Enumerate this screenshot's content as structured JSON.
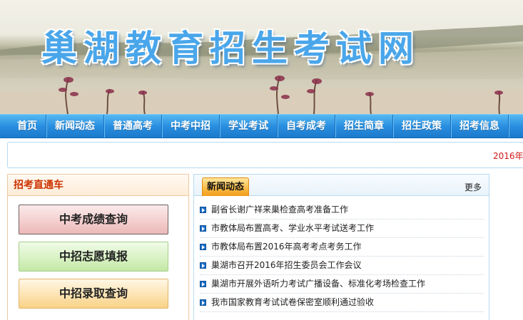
{
  "banner": {
    "title": "巢湖教育招生考试网"
  },
  "nav": {
    "items": [
      "首页",
      "新闻动态",
      "普通高考",
      "中考中招",
      "学业考试",
      "自考成考",
      "招生简章",
      "招生政策",
      "招考信息"
    ]
  },
  "marquee": {
    "text": "2016年"
  },
  "left_panel": {
    "title": "招考直通车",
    "buttons": {
      "score": "中考成绩查询",
      "wish": "中招志愿填报",
      "admit": "中招录取查询"
    }
  },
  "news": {
    "tab_label": "新闻动态",
    "more_label": "更多",
    "items": [
      "副省长谢广祥来巢检查高考准备工作",
      "市教体局布置高考、学业水平考试送考工作",
      "市教体局布置2016年高考考点考务工作",
      "巢湖市召开2016年招生委员会工作会议",
      "巢湖市开展外语听力考试广播设备、标准化考场检查工作",
      "我市国家教育考试试卷保密室顺利通过验收"
    ]
  },
  "colors": {
    "nav_blue": "#2a8fe0",
    "title_blue": "#4aa6ea",
    "accent_red": "#cc3300",
    "tab_orange": "#f9bd49"
  }
}
